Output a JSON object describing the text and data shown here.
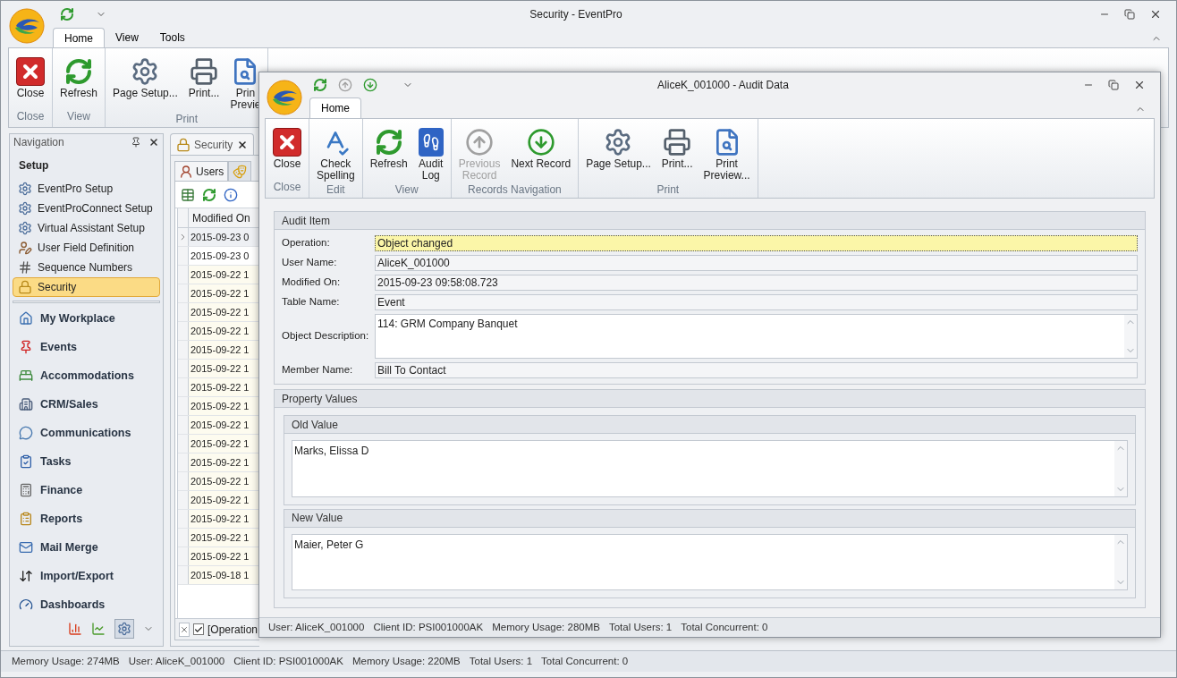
{
  "window": {
    "title": "Security - EventPro"
  },
  "ribbon": {
    "tabs": [
      {
        "label": "Home",
        "selected": true
      },
      {
        "label": "View",
        "selected": false
      },
      {
        "label": "Tools",
        "selected": false
      }
    ],
    "groups": [
      {
        "label": "Close",
        "buttons": [
          {
            "kind": "close",
            "lines": [
              "Close"
            ],
            "disabled": false
          }
        ]
      },
      {
        "label": "View",
        "buttons": [
          {
            "kind": "refresh",
            "lines": [
              "Refresh"
            ],
            "disabled": false
          }
        ]
      },
      {
        "label": "Print",
        "buttons": [
          {
            "kind": "page-setup",
            "lines": [
              "Page Setup..."
            ],
            "disabled": false
          },
          {
            "kind": "print",
            "lines": [
              "Print..."
            ],
            "disabled": false
          },
          {
            "kind": "preview",
            "lines": [
              "Prin",
              "Previe"
            ],
            "disabled": false
          }
        ]
      }
    ]
  },
  "navigation": {
    "title": "Navigation",
    "section": "Setup",
    "items": [
      {
        "label": "EventPro Setup",
        "kind": "gear",
        "selected": false
      },
      {
        "label": "EventProConnect Setup",
        "kind": "gear",
        "selected": false
      },
      {
        "label": "Virtual Assistant Setup",
        "kind": "gear",
        "selected": false
      },
      {
        "label": "User Field Definition",
        "kind": "user",
        "selected": false
      },
      {
        "label": "Sequence Numbers",
        "kind": "hash",
        "selected": false
      },
      {
        "label": "Security",
        "kind": "lock",
        "selected": true
      }
    ],
    "modules": [
      {
        "label": "My Workplace",
        "kind": "home"
      },
      {
        "label": "Events",
        "kind": "pin"
      },
      {
        "label": "Accommodations",
        "kind": "bed"
      },
      {
        "label": "CRM/Sales",
        "kind": "building"
      },
      {
        "label": "Communications",
        "kind": "chat"
      },
      {
        "label": "Tasks",
        "kind": "tasks"
      },
      {
        "label": "Finance",
        "kind": "calculator"
      },
      {
        "label": "Reports",
        "kind": "report"
      },
      {
        "label": "Mail Merge",
        "kind": "mail"
      },
      {
        "label": "Import/Export",
        "kind": "arrows"
      },
      {
        "label": "Dashboards",
        "kind": "gauge"
      }
    ]
  },
  "document": {
    "tab": "Security",
    "sub_tabs": [
      {
        "label": "Users",
        "kind": "users",
        "selected": true
      },
      {
        "kind": "mask",
        "selected": false
      }
    ],
    "grid": {
      "columns": [
        "Modified On"
      ],
      "rows": [
        {
          "cells": [
            "2015-09-23 0"
          ],
          "current": true,
          "highlighted": false
        },
        {
          "cells": [
            "2015-09-23 0"
          ],
          "current": false,
          "highlighted": false
        },
        {
          "cells": [
            "2015-09-22 1"
          ],
          "current": false,
          "highlighted": true
        },
        {
          "cells": [
            "2015-09-22 1"
          ],
          "current": false,
          "highlighted": true
        },
        {
          "cells": [
            "2015-09-22 1"
          ],
          "current": false,
          "highlighted": true
        },
        {
          "cells": [
            "2015-09-22 1"
          ],
          "current": false,
          "highlighted": true
        },
        {
          "cells": [
            "2015-09-22 1"
          ],
          "current": false,
          "highlighted": true
        },
        {
          "cells": [
            "2015-09-22 1"
          ],
          "current": false,
          "highlighted": true
        },
        {
          "cells": [
            "2015-09-22 1"
          ],
          "current": false,
          "highlighted": true
        },
        {
          "cells": [
            "2015-09-22 1"
          ],
          "current": false,
          "highlighted": true
        },
        {
          "cells": [
            "2015-09-22 1"
          ],
          "current": false,
          "highlighted": true
        },
        {
          "cells": [
            "2015-09-22 1"
          ],
          "current": false,
          "highlighted": true
        },
        {
          "cells": [
            "2015-09-22 1"
          ],
          "current": false,
          "highlighted": true
        },
        {
          "cells": [
            "2015-09-22 1"
          ],
          "current": false,
          "highlighted": true
        },
        {
          "cells": [
            "2015-09-22 1"
          ],
          "current": false,
          "highlighted": true
        },
        {
          "cells": [
            "2015-09-22 1"
          ],
          "current": false,
          "highlighted": true
        },
        {
          "cells": [
            "2015-09-22 1"
          ],
          "current": false,
          "highlighted": true
        },
        {
          "cells": [
            "2015-09-22 1"
          ],
          "current": false,
          "highlighted": true
        },
        {
          "cells": [
            "2015-09-18 1"
          ],
          "current": false,
          "highlighted": true
        }
      ],
      "filter": {
        "checked": true,
        "text": "[Operation"
      }
    }
  },
  "status_bar": [
    "Memory Usage: 274MB",
    "User: AliceK_001000",
    "Client ID: PSI001000AK",
    "Memory Usage: 220MB",
    "Total Users: 1",
    "Total Concurrent: 0"
  ],
  "audit_window": {
    "title": "AliceK_001000 - Audit Data",
    "tabs": [
      {
        "label": "Home",
        "selected": true
      }
    ],
    "groups": [
      {
        "label": "Close",
        "buttons": [
          {
            "kind": "close",
            "lines": [
              "Close"
            ],
            "disabled": false
          }
        ]
      },
      {
        "label": "Edit",
        "buttons": [
          {
            "kind": "spelling",
            "lines": [
              "Check",
              "Spelling"
            ],
            "disabled": false
          }
        ]
      },
      {
        "label": "View",
        "buttons": [
          {
            "kind": "refresh",
            "lines": [
              "Refresh"
            ],
            "disabled": false
          },
          {
            "kind": "audit-log",
            "lines": [
              "Audit",
              "Log"
            ],
            "disabled": false
          }
        ]
      },
      {
        "label": "Records Navigation",
        "buttons": [
          {
            "kind": "previous",
            "lines": [
              "Previous",
              "Record"
            ],
            "disabled": true
          },
          {
            "kind": "next",
            "lines": [
              "Next Record"
            ],
            "disabled": false
          }
        ]
      },
      {
        "label": "Print",
        "buttons": [
          {
            "kind": "page-setup",
            "lines": [
              "Page Setup..."
            ],
            "disabled": false
          },
          {
            "kind": "print",
            "lines": [
              "Print..."
            ],
            "disabled": false
          },
          {
            "kind": "preview",
            "lines": [
              "Print",
              "Preview..."
            ],
            "disabled": false
          }
        ]
      }
    ],
    "audit_item": {
      "title": "Audit Item",
      "fields": [
        {
          "label": "Operation:",
          "value": "Object changed",
          "kind": "line",
          "focused": true
        },
        {
          "label": "User Name:",
          "value": "AliceK_001000",
          "kind": "line",
          "focused": false
        },
        {
          "label": "Modified On:",
          "value": "2015-09-23 09:58:08.723",
          "kind": "line",
          "focused": false
        },
        {
          "label": "Table Name:",
          "value": "Event",
          "kind": "line",
          "focused": false
        },
        {
          "label": "Object Description:",
          "value": "114: GRM Company Banquet",
          "kind": "memo",
          "focused": false
        },
        {
          "label": "Member Name:",
          "value": "Bill To Contact",
          "kind": "line",
          "focused": false
        }
      ]
    },
    "property_values": {
      "title": "Property Values",
      "sections": [
        {
          "title": "Old Value",
          "value": "Marks, Elissa D"
        },
        {
          "title": "New Value",
          "value": "Maier, Peter G"
        }
      ]
    },
    "status_bar": [
      "User: AliceK_001000",
      "Client ID: PSI001000AK",
      "Memory Usage: 280MB",
      "Total Users: 1",
      "Total Concurrent: 0"
    ]
  }
}
